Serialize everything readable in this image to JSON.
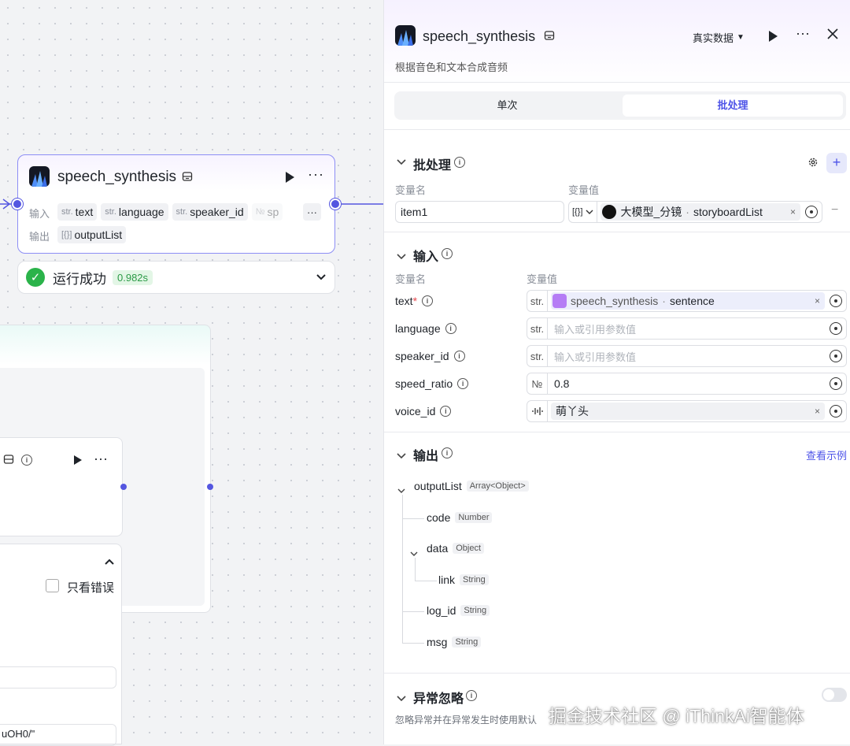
{
  "canvas": {
    "node": {
      "title": "speech_synthesis",
      "input_label": "输入",
      "output_label": "输出",
      "inputs": [
        {
          "type": "str.",
          "name": "text"
        },
        {
          "type": "str.",
          "name": "language"
        },
        {
          "type": "str.",
          "name": "speaker_id"
        },
        {
          "type": "№",
          "name": "sp"
        }
      ],
      "more_label": "···",
      "output": {
        "type": "[{}]",
        "name": "outputList"
      }
    },
    "status": {
      "text": "运行成功",
      "time": "0.982s"
    },
    "lower_panel": {
      "checkbox_label": "只看错误",
      "snippet": "uOH0/\""
    }
  },
  "panel": {
    "title": "speech_synthesis",
    "description": "根据音色和文本合成音频",
    "data_mode": "真实数据",
    "tabs": [
      "单次",
      "批处理"
    ],
    "batch": {
      "title": "批处理",
      "col_name": "变量名",
      "col_value": "变量值",
      "item_name": "item1",
      "item_type": "[{}]",
      "ref_node": "大模型_分镜",
      "ref_field": "storyboardList"
    },
    "input": {
      "title": "输入",
      "col_name": "变量名",
      "col_value": "变量值",
      "params": [
        {
          "name": "text",
          "required": "*",
          "type": "str.",
          "ref_node": "speech_synthesis",
          "ref_field": "sentence"
        },
        {
          "name": "language",
          "type": "str.",
          "placeholder": "输入或引用参数值"
        },
        {
          "name": "speaker_id",
          "type": "str.",
          "placeholder": "输入或引用参数值"
        },
        {
          "name": "speed_ratio",
          "type": "№",
          "value": "0.8"
        },
        {
          "name": "voice_id",
          "type": "wave",
          "value": "萌丫头"
        }
      ]
    },
    "output": {
      "title": "输出",
      "view_example": "查看示例",
      "tree": [
        {
          "name": "outputList",
          "type": "Array<Object>"
        },
        {
          "name": "code",
          "type": "Number"
        },
        {
          "name": "data",
          "type": "Object"
        },
        {
          "name": "link",
          "type": "String"
        },
        {
          "name": "log_id",
          "type": "String"
        },
        {
          "name": "msg",
          "type": "String"
        }
      ]
    },
    "exception": {
      "title": "异常忽略",
      "description": "忽略异常并在异常发生时使用默认"
    }
  },
  "watermark": "掘金技术社区 @ iThinkAi智能体",
  "colors": {
    "accent": "#5456e0",
    "success": "#2bb34a",
    "link": "#4d53e8"
  }
}
